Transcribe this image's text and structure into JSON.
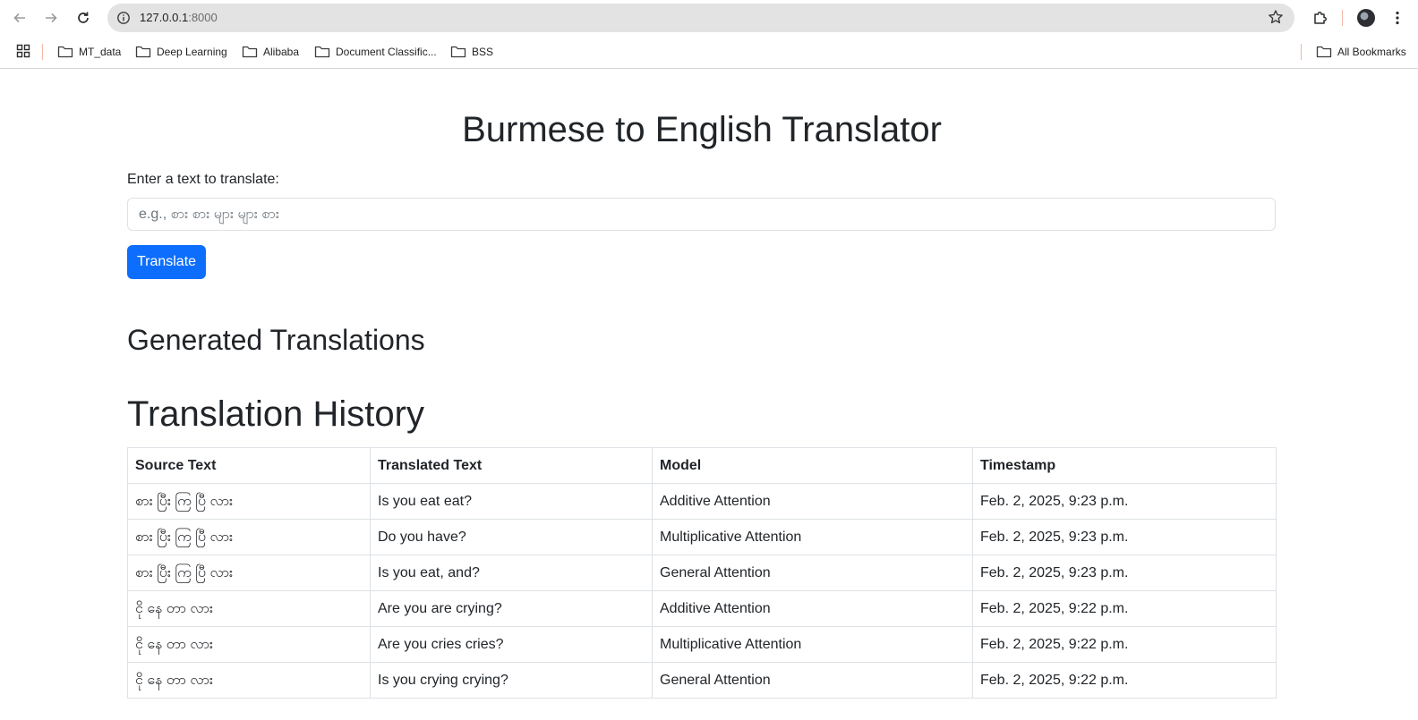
{
  "browser": {
    "url_host": "127.0.0.1",
    "url_port": ":8000",
    "bookmarks": [
      {
        "label": "MT_data"
      },
      {
        "label": "Deep Learning"
      },
      {
        "label": "Alibaba"
      },
      {
        "label": "Document Classific..."
      },
      {
        "label": "BSS"
      }
    ],
    "all_bookmarks_label": "All Bookmarks"
  },
  "page": {
    "title": "Burmese to English Translator",
    "input_label": "Enter a text to translate:",
    "input_placeholder": "e.g., စား စား များ များ စား",
    "input_value": "",
    "translate_button": "Translate",
    "generated_title": "Generated Translations",
    "history_title": "Translation History"
  },
  "history": {
    "columns": [
      "Source Text",
      "Translated Text",
      "Model",
      "Timestamp"
    ],
    "rows": [
      [
        "စား ပြီး ကြ ပြီ လား",
        "Is you eat eat?",
        "Additive Attention",
        "Feb. 2, 2025, 9:23 p.m."
      ],
      [
        "စား ပြီး ကြ ပြီ လား",
        "Do you have?",
        "Multiplicative Attention",
        "Feb. 2, 2025, 9:23 p.m."
      ],
      [
        "စား ပြီး ကြ ပြီ လား",
        "Is you eat, and?",
        "General Attention",
        "Feb. 2, 2025, 9:23 p.m."
      ],
      [
        "ငို နေ တာ လား",
        "Are you are crying?",
        "Additive Attention",
        "Feb. 2, 2025, 9:22 p.m."
      ],
      [
        "ငို နေ တာ လား",
        "Are you cries cries?",
        "Multiplicative Attention",
        "Feb. 2, 2025, 9:22 p.m."
      ],
      [
        "ငို နေ တာ လား",
        "Is you crying crying?",
        "General Attention",
        "Feb. 2, 2025, 9:22 p.m."
      ]
    ]
  },
  "colors": {
    "primary": "#0d6efd",
    "text": "#212529",
    "border": "#dee2e6",
    "omnibox": "#e3e3e4"
  }
}
